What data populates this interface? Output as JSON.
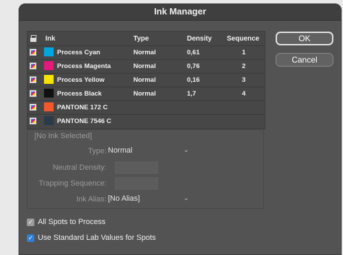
{
  "window": {
    "title": "Ink Manager"
  },
  "table": {
    "headers": {
      "ink": "Ink",
      "type": "Type",
      "density": "Density",
      "sequence": "Sequence"
    },
    "rows": [
      {
        "name": "Process Cyan",
        "type": "Normal",
        "density": "0,61",
        "sequence": "1",
        "color": "#00a7dd"
      },
      {
        "name": "Process Magenta",
        "type": "Normal",
        "density": "0,76",
        "sequence": "2",
        "color": "#e4197a"
      },
      {
        "name": "Process Yellow",
        "type": "Normal",
        "density": "0,16",
        "sequence": "3",
        "color": "#f6e400"
      },
      {
        "name": "Process Black",
        "type": "Normal",
        "density": "1,7",
        "sequence": "4",
        "color": "#111111"
      },
      {
        "name": "PANTONE 172 C",
        "type": "",
        "density": "",
        "sequence": "",
        "color": "#f2582a"
      },
      {
        "name": "PANTONE 7546 C",
        "type": "",
        "density": "",
        "sequence": "",
        "color": "#2b3a48"
      }
    ]
  },
  "buttons": {
    "ok": "OK",
    "cancel": "Cancel"
  },
  "properties": {
    "selection": "[No Ink Selected]",
    "type_label": "Type:",
    "type_value": "Normal",
    "neutral_density_label": "Neutral Density:",
    "trapping_sequence_label": "Trapping Sequence:",
    "ink_alias_label": "Ink Alias:",
    "ink_alias_value": "[No Alias]"
  },
  "checkboxes": {
    "all_spots": {
      "label": "All Spots to Process",
      "checked": true
    },
    "lab_values": {
      "label": "Use Standard Lab Values for Spots",
      "checked": true
    }
  }
}
